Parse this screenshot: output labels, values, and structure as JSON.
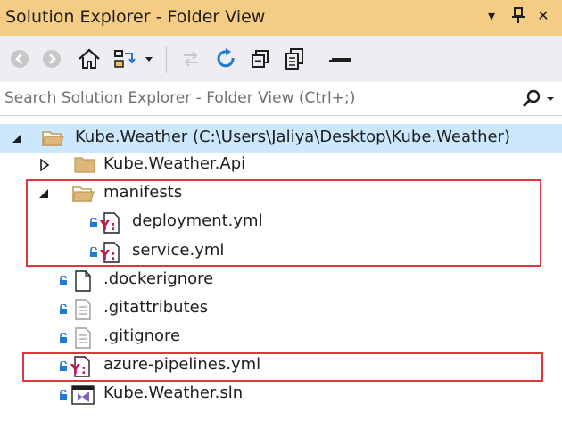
{
  "window": {
    "title": "Solution Explorer - Folder View",
    "buttons": {
      "dropdown": "▾",
      "pin": "⊥",
      "close": "✕"
    }
  },
  "toolbar": {
    "icons": [
      "back-icon",
      "forward-icon",
      "home-icon",
      "switch-views-icon",
      "dropdown-icon",
      "pending-changes-icon",
      "refresh-icon",
      "collapse-all-icon",
      "show-all-files-icon",
      "properties-icon"
    ]
  },
  "search": {
    "placeholder": "Search Solution Explorer - Folder View (Ctrl+;)"
  },
  "tree": {
    "root": {
      "label": "Kube.Weather (C:\\Users\\Jaliya\\Desktop\\Kube.Weather)",
      "expanded": true
    },
    "items": [
      {
        "label": "Kube.Weather.Api",
        "type": "folder",
        "expanded": false
      },
      {
        "label": "manifests",
        "type": "folder",
        "expanded": true
      },
      {
        "label": "deployment.yml",
        "type": "yaml"
      },
      {
        "label": "service.yml",
        "type": "yaml"
      },
      {
        "label": ".dockerignore",
        "type": "file"
      },
      {
        "label": ".gitattributes",
        "type": "text"
      },
      {
        "label": ".gitignore",
        "type": "text"
      },
      {
        "label": "azure-pipelines.yml",
        "type": "yaml"
      },
      {
        "label": "Kube.Weather.sln",
        "type": "solution"
      }
    ]
  },
  "colors": {
    "title_bar": "#f5cc84",
    "toolbar": "#eeeef2",
    "selection": "#cce8ff",
    "highlight_box": "#e0353b",
    "yaml_icon": "#c2185b",
    "lock_icon": "#1e7ad2"
  }
}
